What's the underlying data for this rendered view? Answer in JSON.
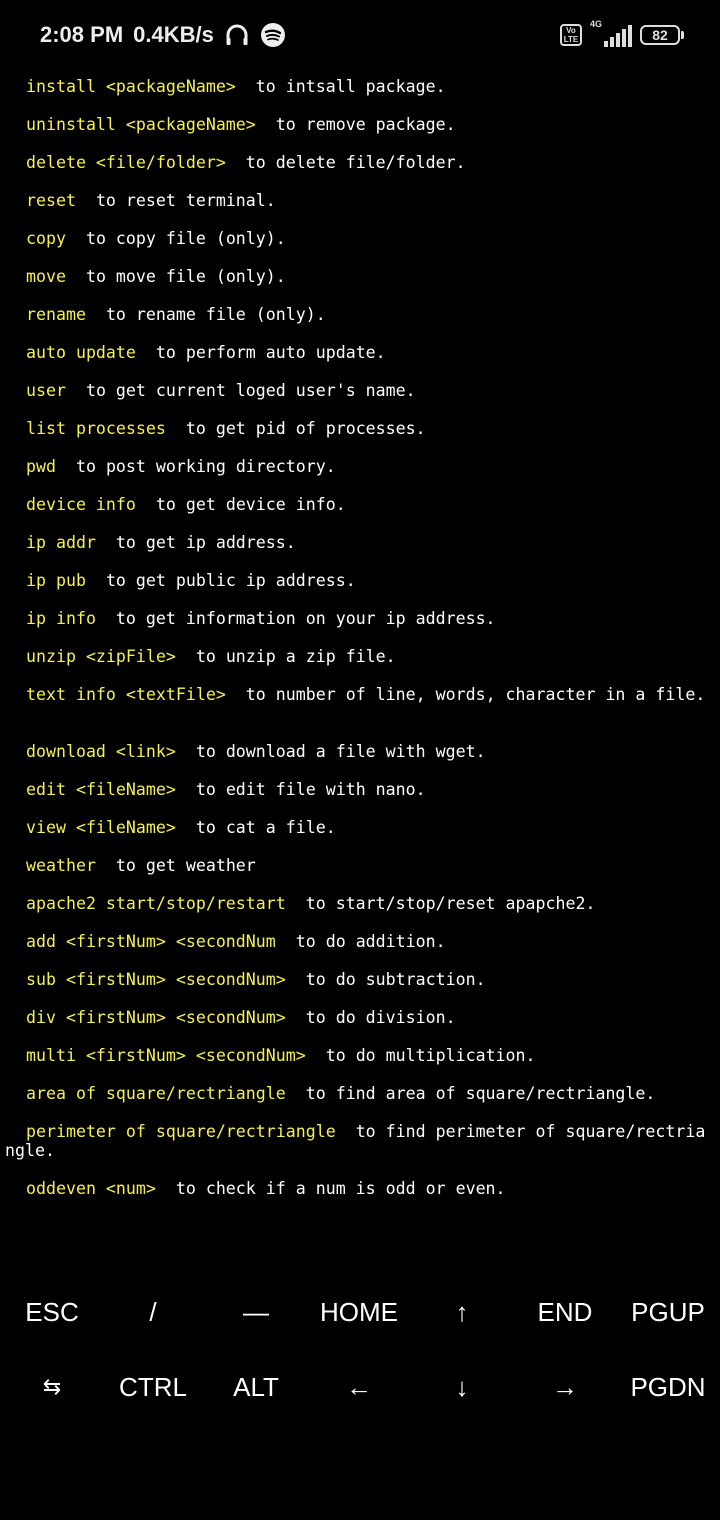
{
  "status_bar": {
    "time": "2:08 PM",
    "speed": "0.4KB/s",
    "network": "4G",
    "volte_top": "Vo",
    "volte_bottom": "LTE",
    "battery": "82"
  },
  "terminal": {
    "commands": [
      {
        "cmd": "install <packageName>",
        "desc": "to intsall package."
      },
      {
        "cmd": "uninstall <packageName>",
        "desc": "to remove package."
      },
      {
        "cmd": "delete <file/folder>",
        "desc": "to delete file/folder."
      },
      {
        "cmd": "reset",
        "desc": "to reset terminal."
      },
      {
        "cmd": "copy",
        "desc": "to copy file (only)."
      },
      {
        "cmd": "move",
        "desc": "to move file (only)."
      },
      {
        "cmd": "rename",
        "desc": "to rename file (only)."
      },
      {
        "cmd": "auto update",
        "desc": "to perform auto update."
      },
      {
        "cmd": "user",
        "desc": "to get current loged user's name."
      },
      {
        "cmd": "list processes",
        "desc": "to get pid of processes."
      },
      {
        "cmd": "pwd",
        "desc": "to post working directory."
      },
      {
        "cmd": "device info",
        "desc": "to get device info."
      },
      {
        "cmd": "ip addr",
        "desc": "to get ip address."
      },
      {
        "cmd": "ip pub",
        "desc": "to get public ip address."
      },
      {
        "cmd": "ip info",
        "desc": "to get information on your ip address."
      },
      {
        "cmd": "unzip <zipFile>",
        "desc": "to unzip a zip file."
      },
      {
        "cmd": "text info <textFile>",
        "desc": "to number of line, words, character in a file."
      },
      {
        "cmd": "download <link>",
        "desc": "to download a file with wget."
      },
      {
        "cmd": "edit <fileName>",
        "desc": "to edit file with nano."
      },
      {
        "cmd": "view <fileName>",
        "desc": "to cat a file."
      },
      {
        "cmd": "weather",
        "desc": "to get weather"
      },
      {
        "cmd": "apache2 start/stop/restart",
        "desc": "to start/stop/reset apapche2."
      },
      {
        "cmd": "add <firstNum> <secondNum",
        "desc": "to do addition."
      },
      {
        "cmd": "sub <firstNum> <secondNum>",
        "desc": "to do subtraction."
      },
      {
        "cmd": "div <firstNum> <secondNum>",
        "desc": "to do division."
      },
      {
        "cmd": "multi <firstNum> <secondNum>",
        "desc": "to do multiplication."
      },
      {
        "cmd": "area of square/rectriangle",
        "desc": "to find area of square/rectriangle."
      },
      {
        "cmd": "perimeter of square/rectriangle",
        "desc": "to find perimeter of square/rectria",
        "wrap": "ngle."
      },
      {
        "cmd": "oddeven <num>",
        "desc": "to check if a num is odd or even."
      }
    ]
  },
  "extra_keys": {
    "row1": [
      "ESC",
      "/",
      "—",
      "HOME",
      "↑",
      "END",
      "PGUP"
    ],
    "row2": [
      "⇆",
      "CTRL",
      "ALT",
      "←",
      "↓",
      "→",
      "PGDN"
    ]
  }
}
